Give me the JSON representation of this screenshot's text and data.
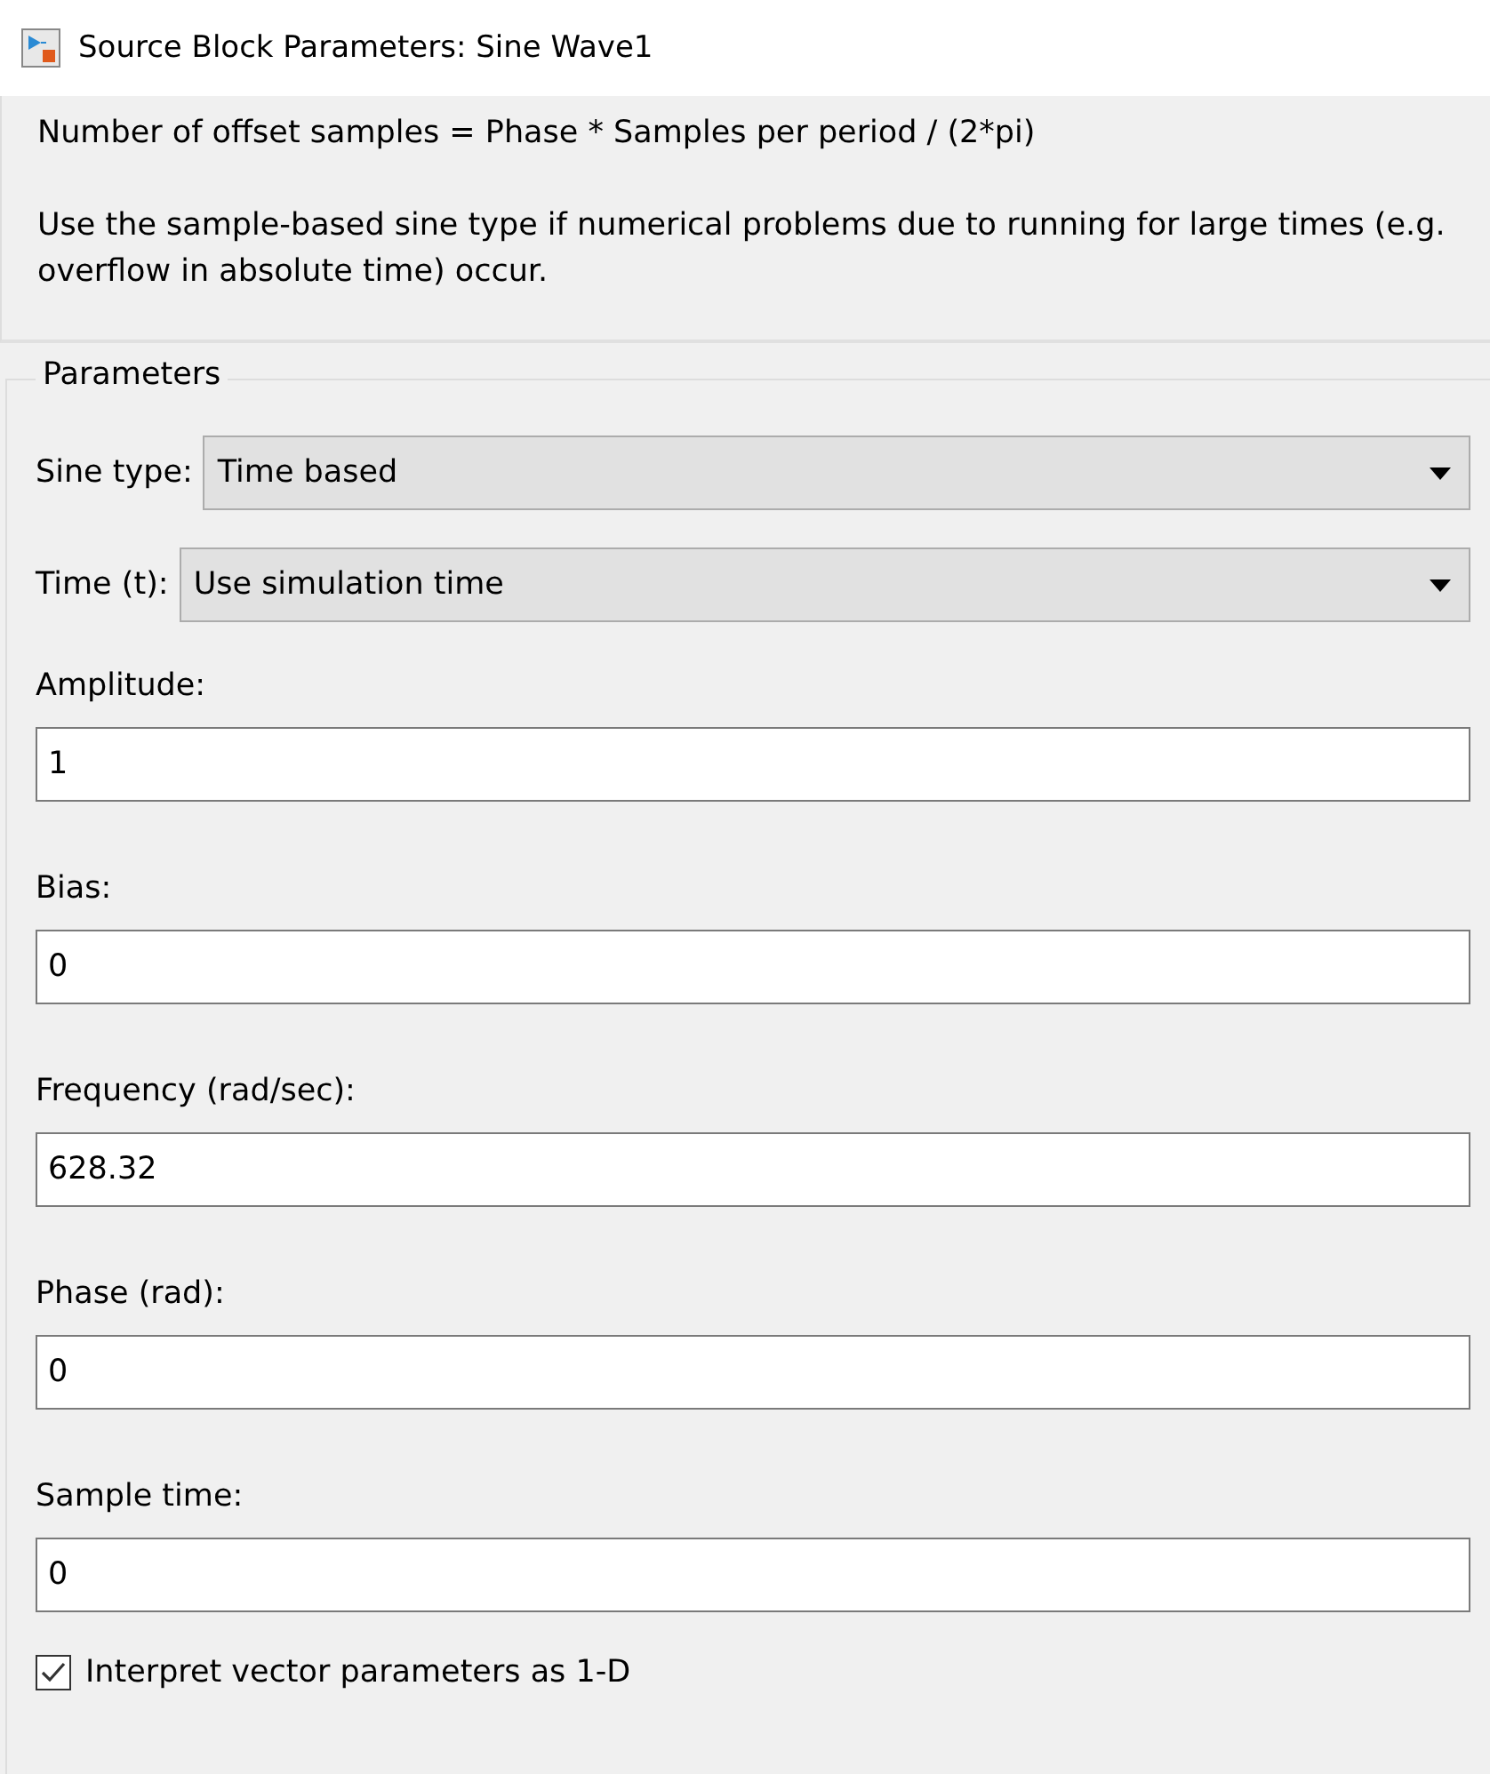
{
  "window": {
    "title": "Source Block Parameters: Sine Wave1"
  },
  "description": [
    "Number of offset samples = Phase * Samples per period / (2*pi)",
    "Use the sample-based sine type if numerical problems due to running for large times (e.g. overflow in absolute time) occur."
  ],
  "parameters": {
    "title": "Parameters",
    "dropdowns": [
      {
        "label": "Sine type:",
        "value": "Time based"
      },
      {
        "label": "Time (t):",
        "value": "Use simulation time"
      }
    ],
    "fields": [
      {
        "label": "Amplitude:",
        "value": "1"
      },
      {
        "label": "Bias:",
        "value": "0"
      },
      {
        "label": "Frequency (rad/sec):",
        "value": "628.32"
      },
      {
        "label": "Phase (rad):",
        "value": "0"
      },
      {
        "label": "Sample time:",
        "value": "0"
      }
    ],
    "checkbox": {
      "label": "Interpret vector parameters as 1-D",
      "checked": true
    }
  }
}
